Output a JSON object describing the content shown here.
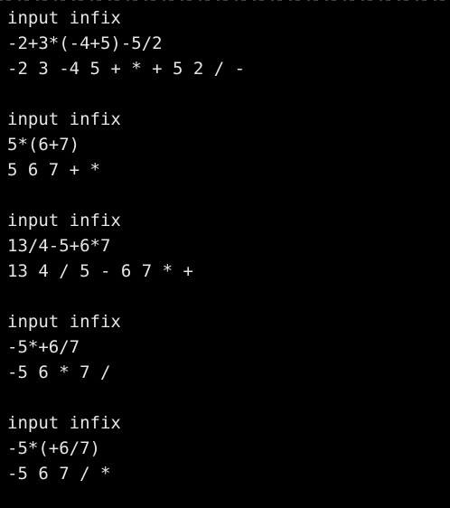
{
  "terminal": {
    "sessions": [
      {
        "prompt": "input infix",
        "input": "-2+3*(-4+5)-5/2",
        "output": "-2 3 -4 5 + * + 5 2 / -"
      },
      {
        "prompt": "input infix",
        "input": "5*(6+7)",
        "output": "5 6 7 + *"
      },
      {
        "prompt": "input infix",
        "input": "13/4-5+6*7",
        "output": "13 4 / 5 - 6 7 * +"
      },
      {
        "prompt": "input infix",
        "input": "-5*+6/7",
        "output": "-5 6 * 7 /"
      },
      {
        "prompt": "input infix",
        "input": "-5*(+6/7)",
        "output": "-5 6 7 / *"
      }
    ]
  }
}
